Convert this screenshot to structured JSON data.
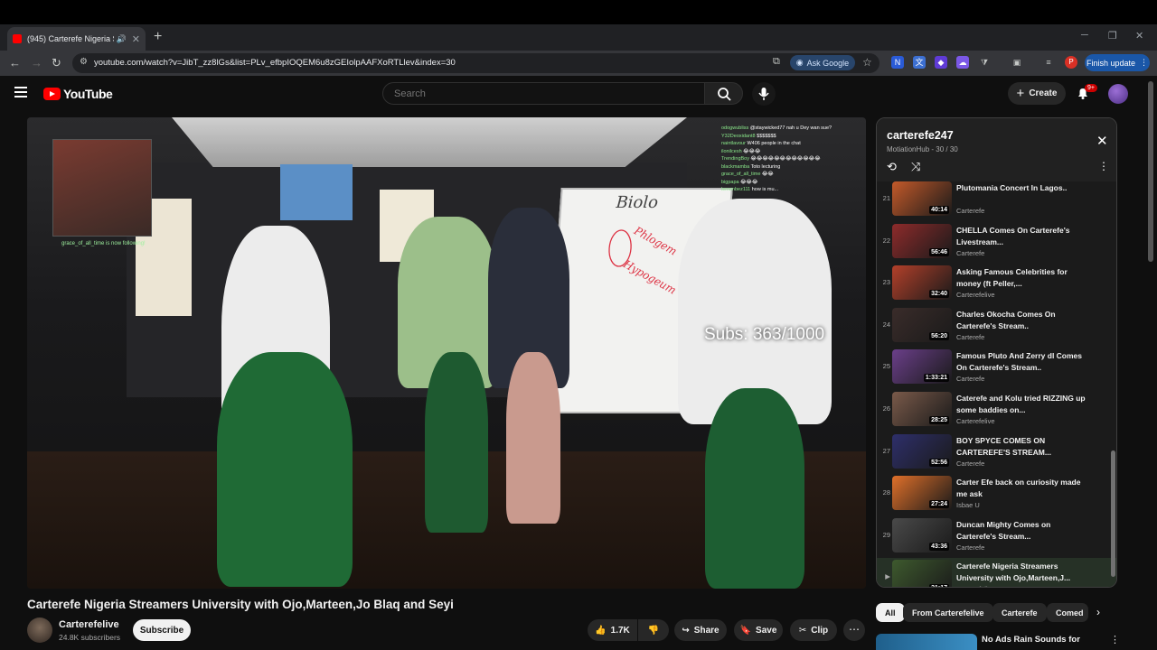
{
  "browser": {
    "tab_title": "(945) Carterefe Nigeria Stre",
    "url": "youtube.com/watch?v=JibT_zz8lGs&list=PLv_efbpIOQEM6u8zGEIolpAAFXoRTLlev&index=30",
    "ask_google": "Ask Google",
    "finish_update": "Finish update",
    "profile_initial": "P"
  },
  "header": {
    "logo_text": "YouTube",
    "search_placeholder": "Search",
    "create_label": "Create",
    "notif_badge": "9+"
  },
  "video": {
    "title": "Carterefe Nigeria Streamers University with Ojo,Marteen,Jo Blaq and Seyi",
    "overlay_subs": "Subs: 363/1000",
    "whiteboard_words": [
      "Biolo",
      "Phlogem",
      "Hypogeum"
    ],
    "cam_caption": "grace_of_all_time is now following!",
    "chat": [
      {
        "user": "odogwubliss",
        "msg": "@staywicked77 nah u Dey wan sue?"
      },
      {
        "user": "Y32Deoxidant8",
        "msg": "$$$$$$$"
      },
      {
        "user": "naintlavour",
        "msg": "W406 people in the chat"
      },
      {
        "user": "ilonilcesh",
        "msg": "😂😂😂"
      },
      {
        "user": "TrendingBoy",
        "msg": "😂😂😂😂😂😂😂😂😂😂😂😂"
      },
      {
        "user": "blackmamba",
        "msg": "Toto lecturing"
      },
      {
        "user": "grace_of_all_time",
        "msg": "😂😂"
      },
      {
        "user": "bigpapa",
        "msg": "😂😂😂"
      },
      {
        "user": "lemonbez111",
        "msg": "how is mu..."
      }
    ]
  },
  "channel": {
    "name": "Carterefelive",
    "subscribers": "24.8K subscribers",
    "subscribe_label": "Subscribe"
  },
  "actions": {
    "likes": "1.7K",
    "share": "Share",
    "save": "Save",
    "clip": "Clip"
  },
  "playlist": {
    "title": "carterefe247",
    "subtitle": "MotiationHub - 30 / 30",
    "items": [
      {
        "index": "21",
        "title": "Plutomania Concert In Lagos..",
        "channel": "Carterefe",
        "duration": "40:14",
        "color": "#c45a2a"
      },
      {
        "index": "22",
        "title": "CHELLA Comes On Carterefe's Livestream...",
        "channel": "Carterefe",
        "duration": "56:46",
        "color": "#8e2b2b"
      },
      {
        "index": "23",
        "title": "Asking Famous Celebrities for money (ft Peller,...",
        "channel": "Carterefelive",
        "duration": "32:40",
        "color": "#b3402a"
      },
      {
        "index": "24",
        "title": "Charles Okocha Comes On Carterefe's Stream..",
        "channel": "Carterefe",
        "duration": "56:20",
        "color": "#3a2c2a"
      },
      {
        "index": "25",
        "title": "Famous Pluto And Zerry dl Comes On Carterefe's Stream..",
        "channel": "Carterefe",
        "duration": "1:33:21",
        "color": "#6b3f8a"
      },
      {
        "index": "26",
        "title": "Caterefe and Kolu tried RIZZING up some baddies on...",
        "channel": "Carterefelive",
        "duration": "28:25",
        "color": "#7a5a4a"
      },
      {
        "index": "27",
        "title": "BOY SPYCE COMES ON CARTEREFE'S STREAM...",
        "channel": "Carterefe",
        "duration": "52:56",
        "color": "#2e2f6b"
      },
      {
        "index": "28",
        "title": "Carter Efe back on curiosity made me ask",
        "channel": "Isbae U",
        "duration": "27:24",
        "color": "#e0702a"
      },
      {
        "index": "29",
        "title": "Duncan Mighty Comes on Carterefe's Stream...",
        "channel": "Carterefe",
        "duration": "43:36",
        "color": "#4a4a4a"
      },
      {
        "index": "30",
        "title": "Carterefe Nigeria Streamers University with Ojo,Marteen,J...",
        "channel": "Carterefelive",
        "duration": "31:17",
        "color": "#3e5a2e"
      }
    ]
  },
  "chips": [
    "All",
    "From Carterefelive",
    "Carterefe",
    "Comed"
  ],
  "next_rec": {
    "title": "No Ads Rain Sounds for"
  }
}
